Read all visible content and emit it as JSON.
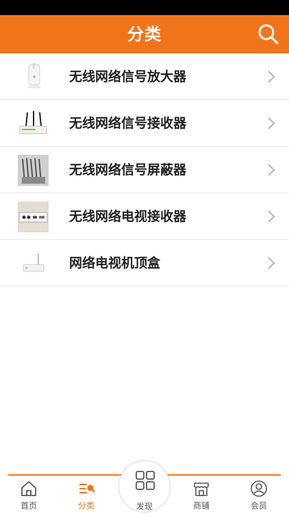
{
  "header": {
    "title": "分类"
  },
  "list": {
    "items": [
      {
        "label": "无线网络信号放大器",
        "thumb": "wifi-extender-image"
      },
      {
        "label": "无线网络信号接收器",
        "thumb": "router-antenna-image"
      },
      {
        "label": "无线网络信号屏蔽器",
        "thumb": "signal-jammer-image"
      },
      {
        "label": "无线网络电视接收器",
        "thumb": "tv-receiver-image"
      },
      {
        "label": "网络电视机顶盒",
        "thumb": "set-top-box-image"
      }
    ]
  },
  "tabbar": {
    "tabs": [
      {
        "label": "首页",
        "icon": "home-icon"
      },
      {
        "label": "分类",
        "icon": "category-icon",
        "active": true
      },
      {
        "label": "发现",
        "icon": "discover-grid-icon"
      },
      {
        "label": "商铺",
        "icon": "store-icon"
      },
      {
        "label": "会员",
        "icon": "user-icon"
      }
    ]
  },
  "colors": {
    "accent": "#f2741a",
    "text": "#222222",
    "divider": "#e6e6e6"
  }
}
